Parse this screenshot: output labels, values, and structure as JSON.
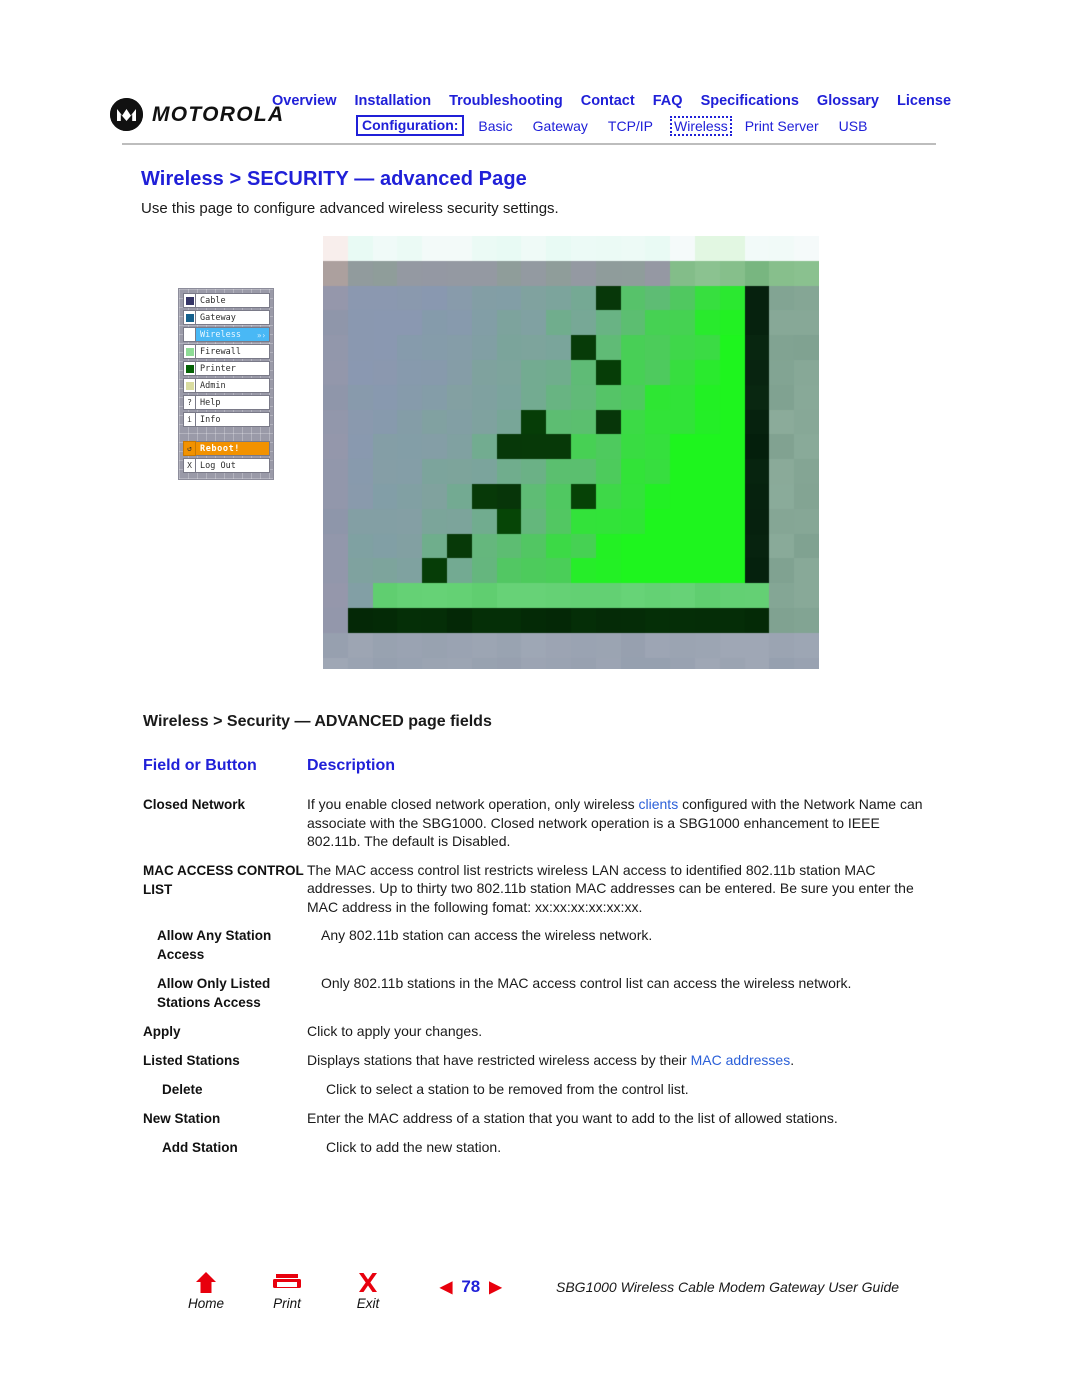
{
  "brand": {
    "name": "MOTOROLA",
    "logo_icon": "motorola-m-logo"
  },
  "nav": {
    "primary": [
      {
        "label": "Overview"
      },
      {
        "label": "Installation"
      },
      {
        "label": "Troubleshooting"
      },
      {
        "label": "Contact"
      },
      {
        "label": "FAQ"
      },
      {
        "label": "Specifications"
      },
      {
        "label": "Glossary"
      },
      {
        "label": "License"
      }
    ],
    "config_label": "Configuration:",
    "secondary": [
      {
        "label": "Basic",
        "selected": false
      },
      {
        "label": "Gateway",
        "selected": false
      },
      {
        "label": "TCP/IP",
        "selected": false
      },
      {
        "label": "Wireless",
        "selected": true
      },
      {
        "label": "Print Server",
        "selected": false
      },
      {
        "label": "USB",
        "selected": false
      }
    ]
  },
  "page": {
    "title": "Wireless > SECURITY — advanced Page",
    "intro": "Use this page to configure advanced wireless security settings.",
    "fields_heading": "Wireless > Security — ADVANCED page fields"
  },
  "screenshot_sidebar": {
    "items": [
      {
        "label": "Cable",
        "chip": "#353566",
        "state": "normal"
      },
      {
        "label": "Gateway",
        "chip": "#15608c",
        "state": "normal"
      },
      {
        "label": "Wireless",
        "chip": "#ffffff",
        "state": "active",
        "arrows": "»›"
      },
      {
        "label": "Firewall",
        "chip": "#8edc96",
        "state": "normal"
      },
      {
        "label": "Printer",
        "chip": "#046104",
        "state": "normal"
      },
      {
        "label": "Admin",
        "chip": "#d9dca0",
        "state": "normal"
      },
      {
        "label": "Help",
        "glyph": "?",
        "state": "normal"
      },
      {
        "label": "Info",
        "glyph": "i",
        "state": "normal"
      },
      {
        "label": "Reboot!",
        "glyph": "↺",
        "state": "reboot"
      },
      {
        "label": "Log Out",
        "glyph": "X",
        "state": "normal"
      }
    ]
  },
  "table": {
    "headers": {
      "col1": "Field or Button",
      "col2": "Description"
    },
    "rows": [
      {
        "name": "Closed Network",
        "indent": 0,
        "desc_parts": [
          {
            "text": "If you enable closed network operation, only wireless ",
            "link": false
          },
          {
            "text": "clients",
            "link": true
          },
          {
            "text": " configured with the Network Name can associate with the SBG1000. Closed network operation is a SBG1000 enhancement to IEEE 802.11b. The default is Disabled.",
            "link": false
          }
        ]
      },
      {
        "name": "MAC ACCESS CONTROL LIST",
        "indent": 0,
        "desc_parts": [
          {
            "text": "The MAC access control list restricts wireless LAN access to identified 802.11b station MAC addresses. Up to thirty two 802.11b station MAC addresses can be entered. Be sure you enter the MAC address in the following fomat:  xx:xx:xx:xx:xx:xx.",
            "link": false
          }
        ]
      },
      {
        "name": "Allow Any Station Access",
        "indent": 1,
        "desc_parts": [
          {
            "text": "Any 802.11b station can access the wireless network.",
            "link": false
          }
        ]
      },
      {
        "name": "Allow Only Listed Stations Access",
        "indent": 1,
        "desc_parts": [
          {
            "text": "Only 802.11b stations in the MAC access control list can access the wireless network.",
            "link": false
          }
        ]
      },
      {
        "name": "Apply",
        "indent": 0,
        "desc_parts": [
          {
            "text": "Click to apply your changes.",
            "link": false
          }
        ]
      },
      {
        "name": "Listed Stations",
        "indent": 0,
        "desc_parts": [
          {
            "text": "Displays stations that have restricted wireless access by their ",
            "link": false
          },
          {
            "text": "MAC addresses",
            "link": true
          },
          {
            "text": ".",
            "link": false
          }
        ]
      },
      {
        "name": "Delete",
        "indent": 2,
        "desc_parts": [
          {
            "text": "Click to select a station to be removed from the control list.",
            "link": false
          }
        ]
      },
      {
        "name": "New Station",
        "indent": 0,
        "desc_parts": [
          {
            "text": "Enter the MAC address of a station that you want to add to the list of allowed stations.",
            "link": false
          }
        ]
      },
      {
        "name": "Add Station",
        "indent": 2,
        "desc_parts": [
          {
            "text": "Click to add the new station.",
            "link": false
          }
        ]
      }
    ]
  },
  "footer": {
    "buttons": [
      {
        "label": "Home",
        "icon": "home-icon"
      },
      {
        "label": "Print",
        "icon": "printer-icon"
      },
      {
        "label": "Exit",
        "icon": "close-x-icon"
      }
    ],
    "prev_icon": "◀",
    "next_icon": "▶",
    "page_number": "78",
    "doc_title": "SBG1000 Wireless Cable Modem Gateway User Guide"
  },
  "colors": {
    "brand_blue": "#2020d8",
    "accent_red": "#e8000d",
    "reboot_orange": "#f29200",
    "active_blue": "#49b8f5"
  }
}
